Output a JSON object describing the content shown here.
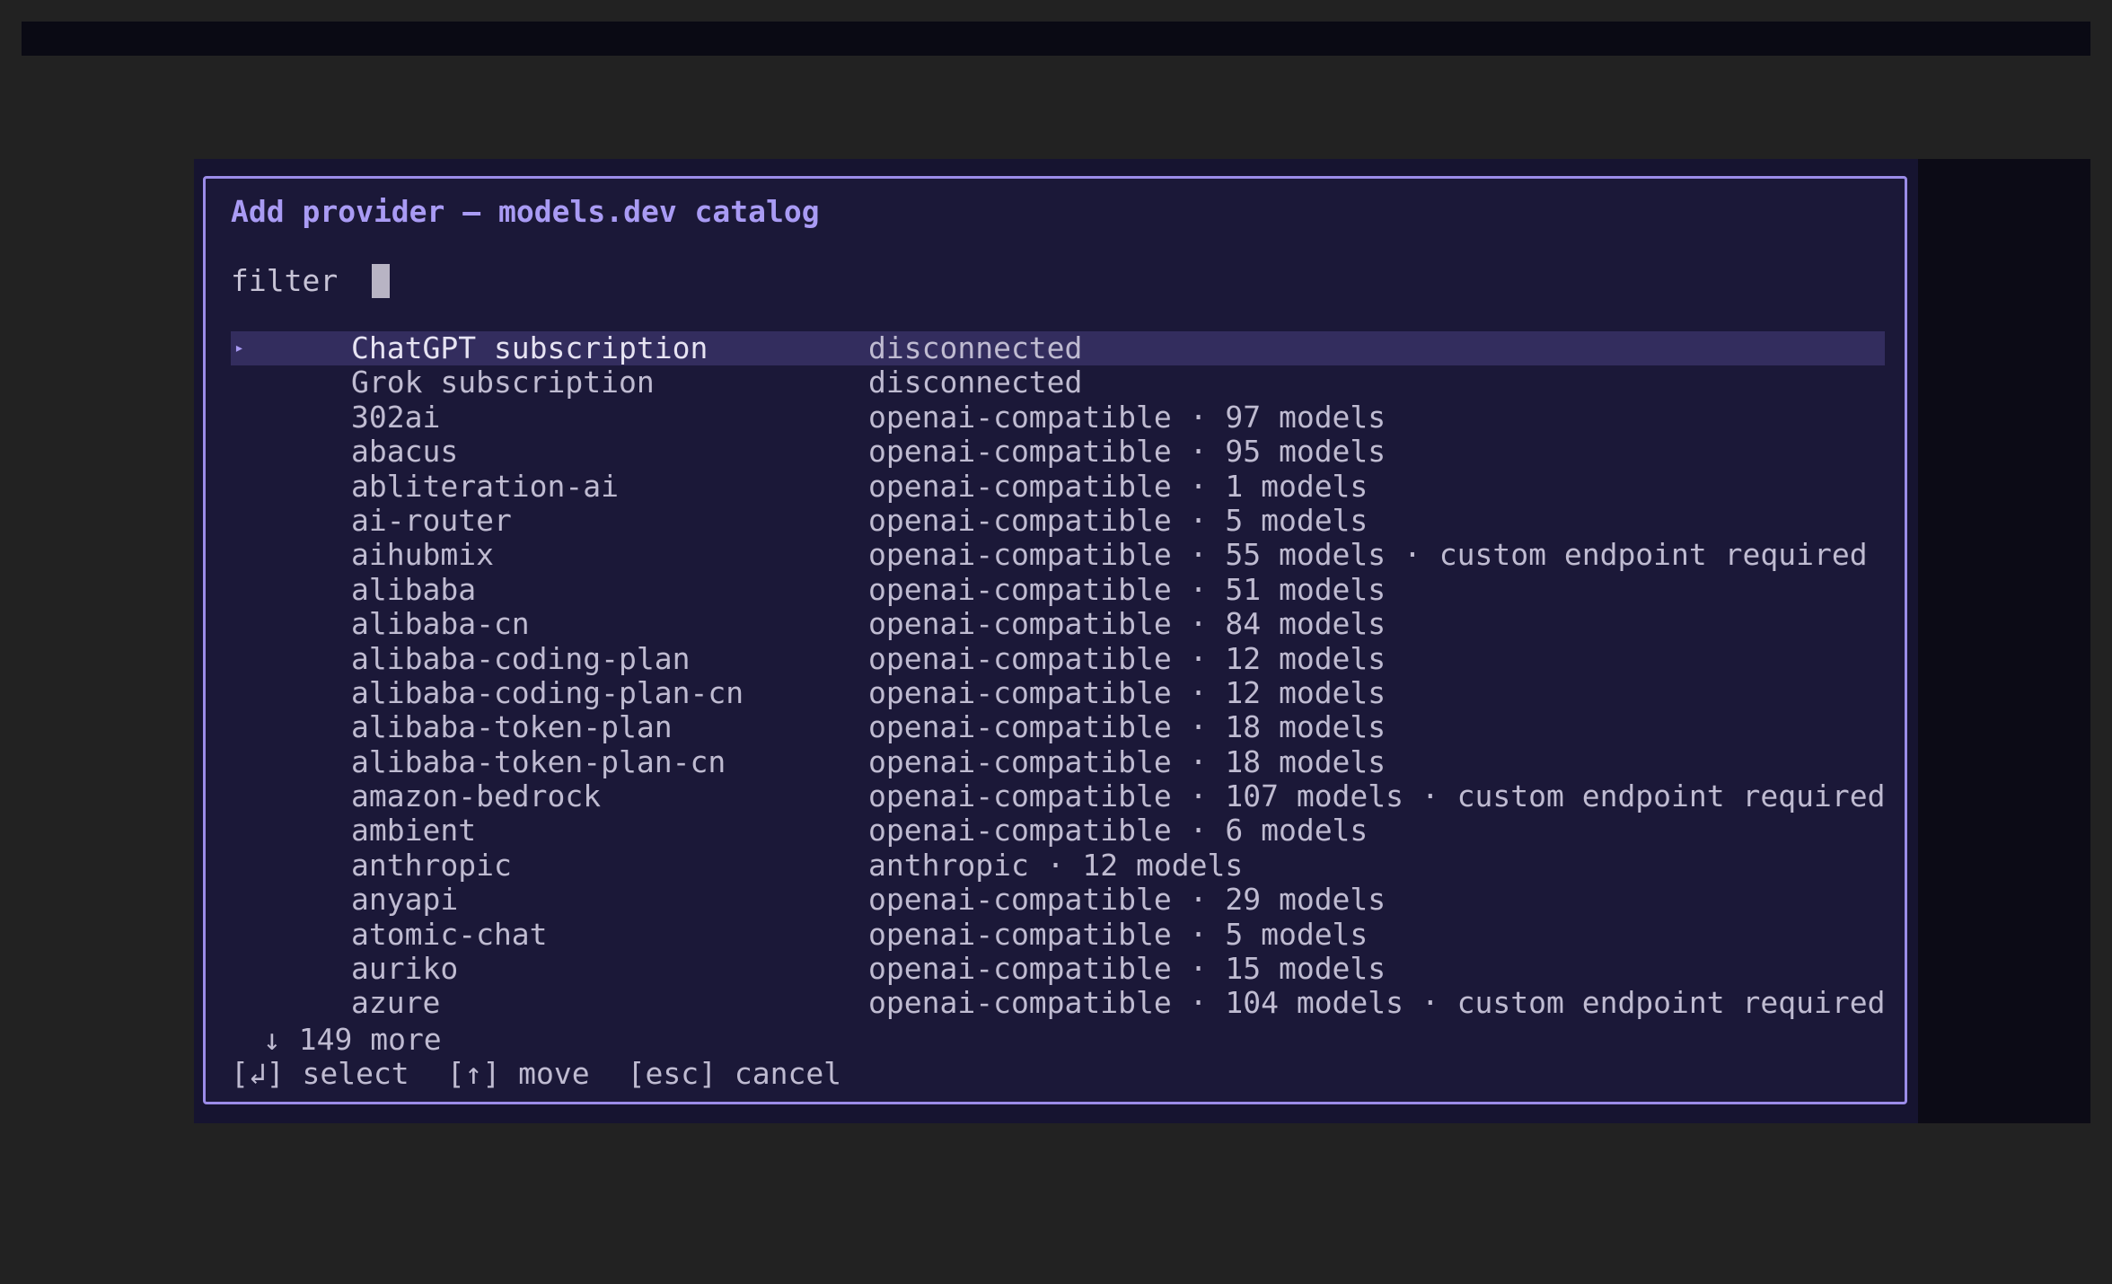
{
  "modal": {
    "title": "Add provider — models.dev catalog",
    "filter_label": "filter",
    "filter_value": "",
    "selected_marker": "▸",
    "more_text": "↓ 149 more",
    "hints": [
      "[↲] select",
      "[↑] move",
      "[esc] cancel"
    ]
  },
  "providers": [
    {
      "name": "ChatGPT subscription",
      "desc": "disconnected"
    },
    {
      "name": "Grok subscription",
      "desc": "disconnected"
    },
    {
      "name": "302ai",
      "desc": "openai-compatible · 97 models"
    },
    {
      "name": "abacus",
      "desc": "openai-compatible · 95 models"
    },
    {
      "name": "abliteration-ai",
      "desc": "openai-compatible · 1 models"
    },
    {
      "name": "ai-router",
      "desc": "openai-compatible · 5 models"
    },
    {
      "name": "aihubmix",
      "desc": "openai-compatible · 55 models · custom endpoint required"
    },
    {
      "name": "alibaba",
      "desc": "openai-compatible · 51 models"
    },
    {
      "name": "alibaba-cn",
      "desc": "openai-compatible · 84 models"
    },
    {
      "name": "alibaba-coding-plan",
      "desc": "openai-compatible · 12 models"
    },
    {
      "name": "alibaba-coding-plan-cn",
      "desc": "openai-compatible · 12 models"
    },
    {
      "name": "alibaba-token-plan",
      "desc": "openai-compatible · 18 models"
    },
    {
      "name": "alibaba-token-plan-cn",
      "desc": "openai-compatible · 18 models"
    },
    {
      "name": "amazon-bedrock",
      "desc": "openai-compatible · 107 models · custom endpoint required"
    },
    {
      "name": "ambient",
      "desc": "openai-compatible · 6 models"
    },
    {
      "name": "anthropic",
      "desc": "anthropic · 12 models"
    },
    {
      "name": "anyapi",
      "desc": "openai-compatible · 29 models"
    },
    {
      "name": "atomic-chat",
      "desc": "openai-compatible · 5 models"
    },
    {
      "name": "auriko",
      "desc": "openai-compatible · 15 models"
    },
    {
      "name": "azure",
      "desc": "openai-compatible · 104 models · custom endpoint required"
    }
  ],
  "colors": {
    "accent": "#9b8ce8",
    "modal_bg": "#1b1838",
    "selected_bg": "#332d5e",
    "text": "#bfbbd1"
  }
}
